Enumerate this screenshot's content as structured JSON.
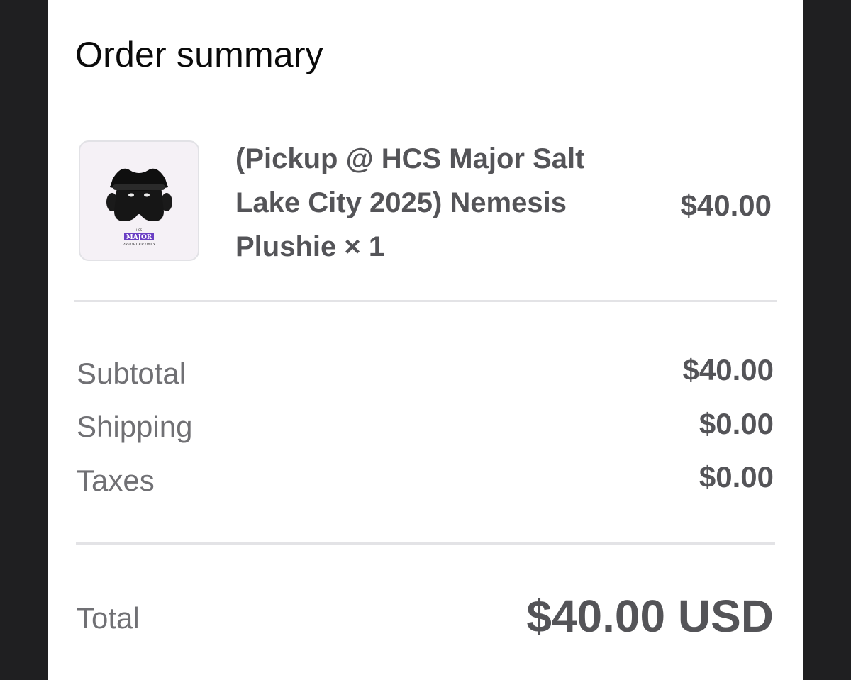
{
  "summary": {
    "title": "Order summary"
  },
  "item": {
    "image_icon": "plushie-product-image",
    "image_badge": "MAJOR",
    "image_caption": "PREORDER ONLY",
    "name": "(Pickup @ HCS Major Salt Lake City 2025) Nemesis Plushie × 1",
    "price": "$40.00"
  },
  "totals": {
    "subtotal_label": "Subtotal",
    "subtotal_value": "$40.00",
    "shipping_label": "Shipping",
    "shipping_value": "$0.00",
    "taxes_label": "Taxes",
    "taxes_value": "$0.00",
    "total_label": "Total",
    "total_value": "$40.00 USD"
  },
  "colors": {
    "background": "#1f1f21",
    "panel": "#ffffff",
    "badge": "#6a3fc4"
  }
}
